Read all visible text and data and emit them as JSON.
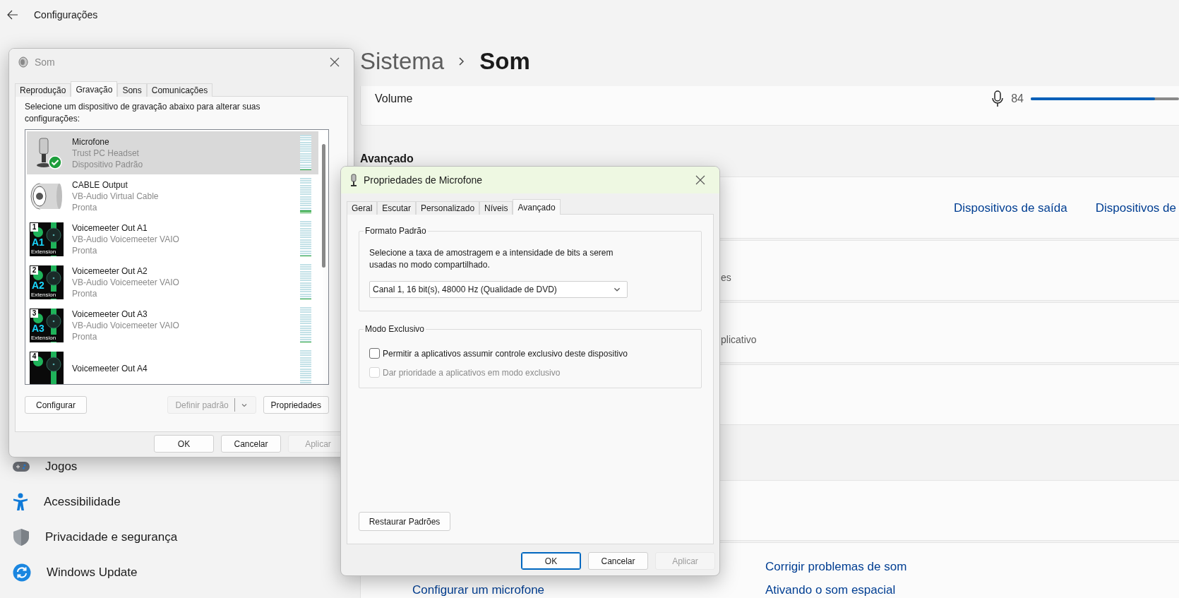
{
  "settings": {
    "title": "Configurações",
    "breadcrumb": {
      "parent": "Sistema",
      "current": "Som"
    },
    "volume": {
      "label": "Volume",
      "reading": "84",
      "level": 0.84
    },
    "section_title": "Avançado",
    "device_links": [
      "Dispositivos de saída",
      "Dispositivos de"
    ],
    "row_subtitles": [
      "es",
      "plicativo"
    ],
    "related_links_left": [
      "Configurar um microfone"
    ],
    "related_links_right": [
      "Corrigir problemas de som",
      "Ativando o som espacial"
    ],
    "sidebar": {
      "items": [
        {
          "label": "Jogos",
          "kind": "gamepad"
        },
        {
          "label": "Acessibilidade",
          "kind": "person"
        },
        {
          "label": "Privacidade e segurança",
          "kind": "shield"
        },
        {
          "label": "Windows Update",
          "kind": "update"
        }
      ]
    }
  },
  "sound_dialog": {
    "title": "Som",
    "tabs": [
      {
        "label": "Reprodução",
        "selected": false
      },
      {
        "label": "Gravação",
        "selected": true
      },
      {
        "label": "Sons",
        "selected": false
      },
      {
        "label": "Comunicações",
        "selected": false
      }
    ],
    "instruction": "Selecione um dispositivo de gravação abaixo para alterar suas configurações:",
    "devices": [
      {
        "kind": "mic",
        "name": "Microfone",
        "description": "Trust PC Headset",
        "status": "Dispositivo Padrão",
        "is_default": true,
        "selected": true,
        "level": 0
      },
      {
        "kind": "cable",
        "name": "CABLE Output",
        "description": "VB-Audio Virtual Cable",
        "status": "Pronta",
        "is_default": false,
        "selected": false,
        "level": 0.08
      },
      {
        "kind": "voicemeeter",
        "badge": "1",
        "icon_label": "A1",
        "icon_caption": "Extension",
        "name": "Voicemeeter Out A1",
        "description": "VB-Audio Voicemeeter VAIO",
        "status": "Pronta",
        "is_default": false,
        "selected": false,
        "level": 0
      },
      {
        "kind": "voicemeeter",
        "badge": "2",
        "icon_label": "A2",
        "icon_caption": "Extension",
        "name": "Voicemeeter Out A2",
        "description": "VB-Audio Voicemeeter VAIO",
        "status": "Pronta",
        "is_default": false,
        "selected": false,
        "level": 0
      },
      {
        "kind": "voicemeeter",
        "badge": "3",
        "icon_label": "A3",
        "icon_caption": "Extension",
        "name": "Voicemeeter Out A3",
        "description": "VB-Audio Voicemeeter VAIO",
        "status": "Pronta",
        "is_default": false,
        "selected": false,
        "level": 0
      },
      {
        "kind": "voicemeeter",
        "badge": "4",
        "name": "Voicemeeter Out A4",
        "is_default": false,
        "selected": false
      }
    ],
    "configure_button": {
      "label": "Configurar",
      "disabled": false
    },
    "set_default_button": {
      "label": "Definir padrão",
      "disabled": true
    },
    "properties_button": {
      "label": "Propriedades",
      "disabled": false
    },
    "buttons": [
      {
        "label": "OK",
        "disabled": false
      },
      {
        "label": "Cancelar",
        "disabled": false
      },
      {
        "label": "Aplicar",
        "disabled": true
      }
    ]
  },
  "properties_dialog": {
    "title": "Propriedades de Microfone",
    "tabs": [
      {
        "label": "Geral",
        "selected": false
      },
      {
        "label": "Escutar",
        "selected": false
      },
      {
        "label": "Personalizado",
        "selected": false
      },
      {
        "label": "Níveis",
        "selected": false
      },
      {
        "label": "Avançado",
        "selected": true
      }
    ],
    "format_group": {
      "title": "Formato Padrão",
      "description": "Selecione a taxa de amostragem e a intensidade de bits a serem usadas no modo compartilhado.",
      "value": "Canal 1, 16 bit(s), 48000 Hz (Qualidade de DVD)"
    },
    "exclusive_group": {
      "title": "Modo Exclusivo",
      "options": [
        {
          "label": "Permitir a aplicativos assumir controle exclusivo deste dispositivo",
          "checked": false,
          "disabled": false
        },
        {
          "label": "Dar prioridade a aplicativos em modo exclusivo",
          "checked": false,
          "disabled": true
        }
      ]
    },
    "restore_button": "Restaurar Padrões",
    "buttons": [
      {
        "label": "OK",
        "disabled": false,
        "focused": true
      },
      {
        "label": "Cancelar",
        "disabled": false,
        "focused": false
      },
      {
        "label": "Aplicar",
        "disabled": true,
        "focused": false
      }
    ]
  }
}
